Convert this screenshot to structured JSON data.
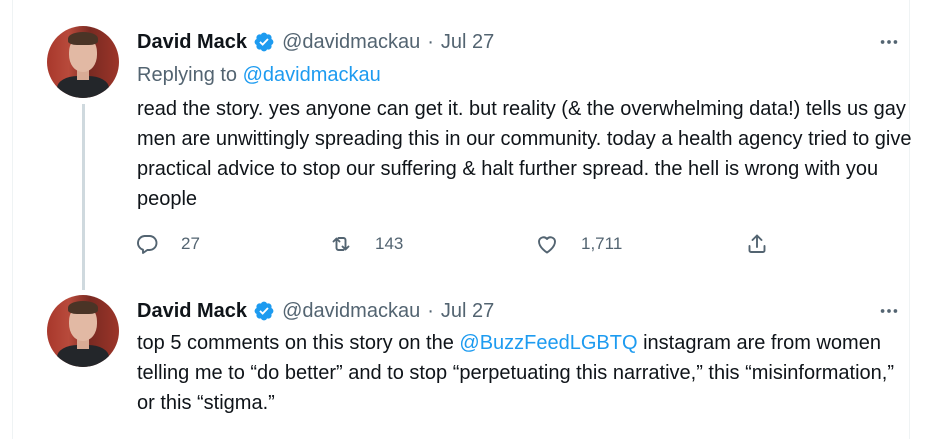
{
  "tweets": [
    {
      "name": "David Mack",
      "handle": "@davidmackau",
      "separator": "·",
      "date": "Jul 27",
      "replying_prefix": "Replying to",
      "replying_to": "@davidmackau",
      "text": "read the story. yes anyone can get it. but reality (& the overwhelming data!) tells us gay men are unwittingly spreading this in our community. today a health agency tried to give practical advice to stop our suffering & halt further spread. the hell is wrong with you people",
      "reply_count": "27",
      "retweet_count": "143",
      "like_count": "1,711"
    },
    {
      "name": "David Mack",
      "handle": "@davidmackau",
      "separator": "·",
      "date": "Jul 27",
      "text_before_mention": "top 5 comments on this story on the ",
      "mention": "@BuzzFeedLGBTQ",
      "text_after_mention": " instagram are from women telling me to “do better” and to stop “perpetuating this narrative,” this “misinformation,” or this “stigma.”"
    }
  ],
  "icons": {
    "verified": "verified-badge-icon",
    "more": "more-horizontal-icon",
    "reply": "reply-icon",
    "retweet": "retweet-icon",
    "like": "heart-icon",
    "share": "share-icon"
  },
  "colors": {
    "text": "#0f1419",
    "secondary": "#536471",
    "link": "#1d9bf0",
    "verified": "#1d9bf0",
    "thread_line": "#cfd9de"
  }
}
